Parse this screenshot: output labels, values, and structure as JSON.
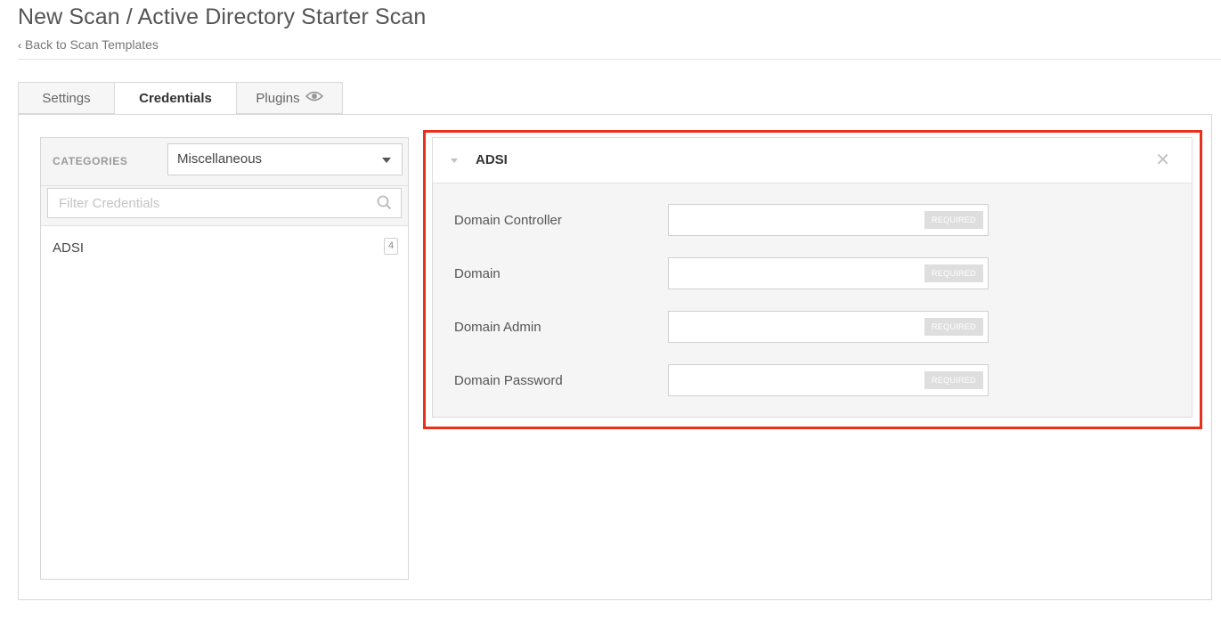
{
  "header": {
    "title": "New Scan / Active Directory Starter Scan",
    "back_link": "Back to Scan Templates"
  },
  "tabs": [
    {
      "label": "Settings"
    },
    {
      "label": "Credentials",
      "active": true
    },
    {
      "label": "Plugins",
      "icon": "eye-icon"
    }
  ],
  "categories": {
    "label": "CATEGORIES",
    "selected": "Miscellaneous",
    "filter_placeholder": "Filter Credentials",
    "items": [
      {
        "name": "ADSI",
        "count": "4"
      }
    ]
  },
  "credential_form": {
    "title": "ADSI",
    "fields": [
      {
        "label": "Domain Controller",
        "badge": "REQUIRED"
      },
      {
        "label": "Domain",
        "badge": "REQUIRED"
      },
      {
        "label": "Domain Admin",
        "badge": "REQUIRED"
      },
      {
        "label": "Domain Password",
        "badge": "REQUIRED"
      }
    ]
  },
  "colors": {
    "highlight_border": "#e8301c",
    "required_badge": "#dedede"
  }
}
